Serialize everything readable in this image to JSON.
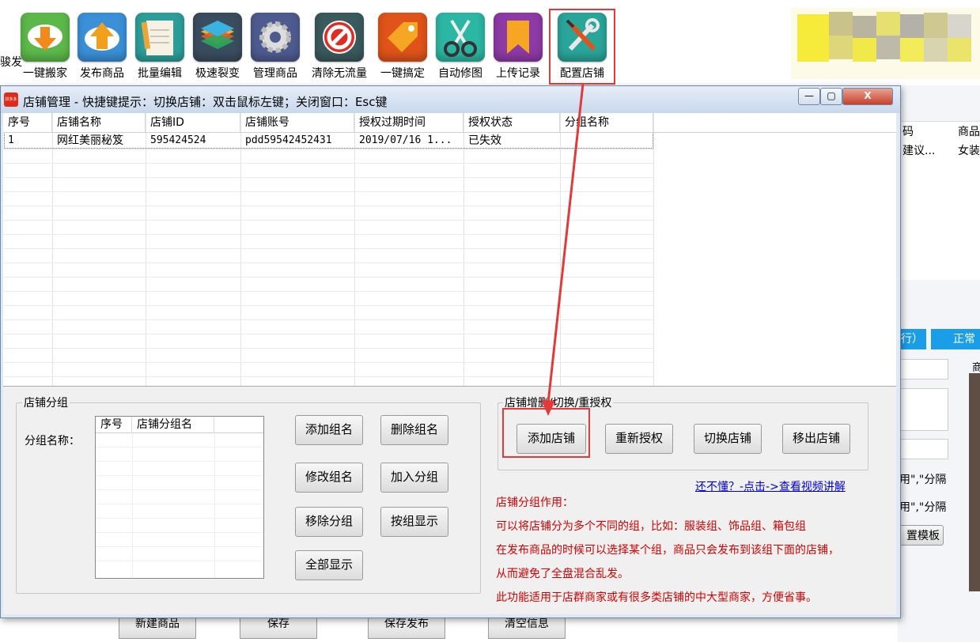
{
  "toolbar": {
    "left_fragment": "骏发",
    "items": [
      {
        "label": "一键搬家",
        "icon": "cloud-download-icon",
        "color": "#5db84a"
      },
      {
        "label": "发布商品",
        "icon": "cloud-upload-icon",
        "color": "#3b90d8"
      },
      {
        "label": "批量编辑",
        "icon": "notepad-pencil-icon",
        "color": "#2c9f9b"
      },
      {
        "label": "极速裂变",
        "icon": "layers-icon",
        "color": "#3a4d5f"
      },
      {
        "label": "管理商品",
        "icon": "gear-icon",
        "color": "#4e5b8e"
      },
      {
        "label": "清除无流量",
        "icon": "prohibit-icon",
        "color": "#3a5a5e"
      },
      {
        "label": "一键搞定",
        "icon": "tag-icon",
        "color": "#e0541a"
      },
      {
        "label": "自动修图",
        "icon": "scissors-icon",
        "color": "#2cb7a4"
      },
      {
        "label": "上传记录",
        "icon": "bookmark-icon",
        "color": "#8e3aa6"
      },
      {
        "label": "配置店铺",
        "icon": "wrench-screwdriver-icon",
        "color": "#2aa59a"
      }
    ]
  },
  "background_app": {
    "col_code_header": "码",
    "col_goods_header": "商品",
    "row_code": "建议...",
    "row_goods": "女装",
    "blue_btn1": "行）",
    "blue_btn2": "正常",
    "side_label": "商",
    "hint1": "用\",\"分隔",
    "hint2": "用\",\"分隔",
    "template_btn": "置模板",
    "bottom_buttons": [
      "新建商品",
      "保存",
      "保存发布",
      "清空信息"
    ]
  },
  "dialog": {
    "title": "店铺管理 - 快捷键提示：切换店铺：双击鼠标左键；关闭窗口：Esc键",
    "app_icon_label": "拼多多",
    "minimize": "—",
    "maximize": "▢",
    "close": "X",
    "table": {
      "columns": [
        "序号",
        "店铺名称",
        "店铺ID",
        "店铺账号",
        "授权过期时间",
        "授权状态",
        "分组名称"
      ],
      "rows": [
        [
          "1",
          "网红美丽秘笈",
          "595424524",
          "pdd59542452431",
          "2019/07/16 1...",
          "已失效",
          ""
        ]
      ]
    },
    "group_panel": {
      "legend": "店铺分组",
      "label": "分组名称：",
      "list_columns": [
        "序号",
        "店铺分组名"
      ],
      "buttons": [
        "添加组名",
        "删除组名",
        "修改组名",
        "加入分组",
        "移除分组",
        "按组显示",
        "全部显示"
      ]
    },
    "shop_panel": {
      "legend": "店铺增删/切换/重授权",
      "buttons": [
        "添加店铺",
        "重新授权",
        "切换店铺",
        "移出店铺"
      ],
      "help_link": "还不懂？-点击->查看视频讲解",
      "notes": [
        "店铺分组作用：",
        "可以将店铺分为多个不同的组，比如：服装组、饰品组、箱包组",
        "在发布商品的时候可以选择某个组，商品只会发布到该组下面的店铺，",
        "从而避免了全盘混合乱发。",
        "此功能适用于店群商家或有很多类店铺的中大型商家，方便省事。"
      ]
    }
  },
  "colors": {
    "annotation_red": "#e23a3a",
    "note_red": "#d40000",
    "link_blue": "#0000cc"
  }
}
